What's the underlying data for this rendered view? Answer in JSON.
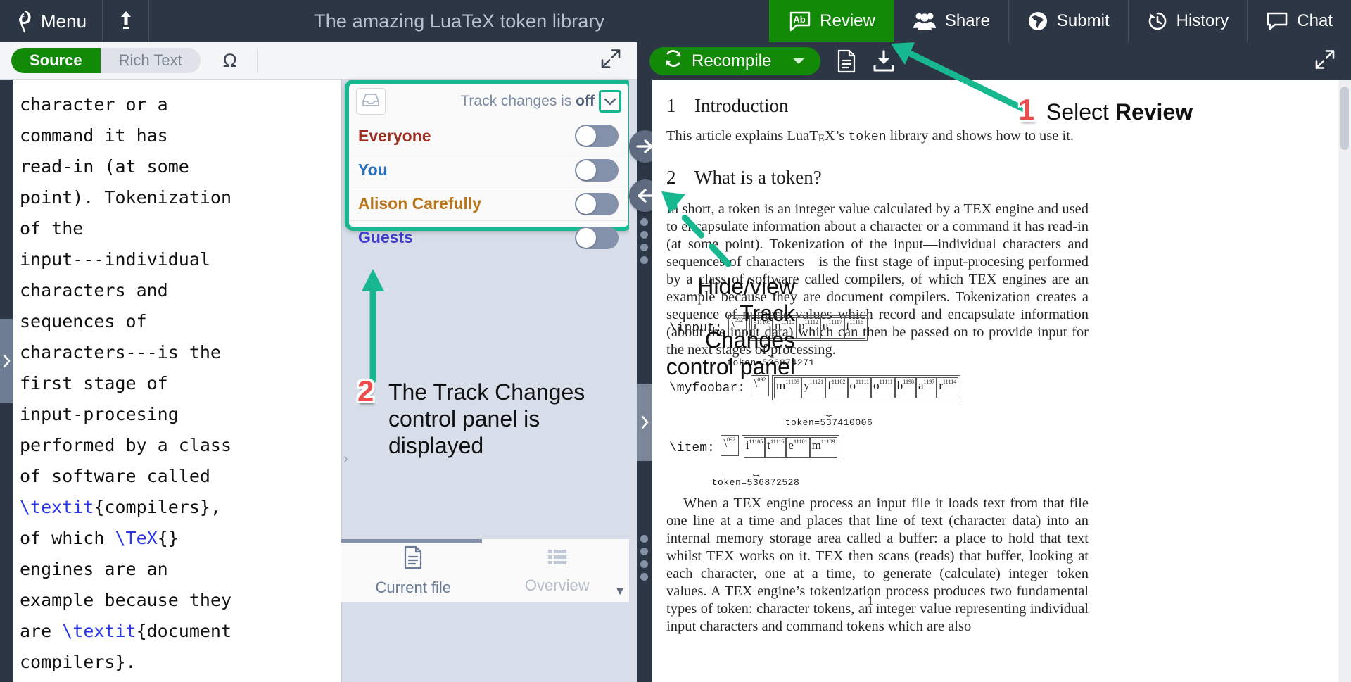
{
  "topnav": {
    "menu_label": "Menu",
    "logo_icon": "overleaf-leaf-logo",
    "upload_icon": "upload-arrow-icon",
    "project_title": "The amazing LuaTeX token library",
    "buttons": [
      {
        "label": "Review",
        "icon": "review-speech-ab-icon",
        "active": true
      },
      {
        "label": "Share",
        "icon": "people-group-icon",
        "active": false
      },
      {
        "label": "Submit",
        "icon": "globe-icon",
        "active": false
      },
      {
        "label": "History",
        "icon": "history-clock-icon",
        "active": false
      },
      {
        "label": "Chat",
        "icon": "chat-bubble-icon",
        "active": false
      }
    ]
  },
  "editor_toolbar": {
    "source_label": "Source",
    "richtext_label": "Rich Text",
    "omega_label": "Ω",
    "expand_icon": "expand-diagonal-icon"
  },
  "pdf_toolbar": {
    "recompile_label": "Recompile",
    "recompile_icon": "refresh-icon",
    "caret_icon": "chevron-down-icon",
    "logs_icon": "file-log-icon",
    "download_icon": "download-icon",
    "expand_icon": "expand-diagonal-icon"
  },
  "editor": {
    "lines": [
      "character or a",
      "command it has",
      "read-in (at some",
      "point). Tokenization",
      "of the",
      "input---individual",
      "characters and",
      "sequences of",
      "characters---is the",
      "first stage of",
      "input-procesing",
      "performed by a class",
      "of software called",
      "\\textit{compilers},",
      "of which \\TeX{}",
      "engines are an",
      "example because they",
      "are \\textit{document",
      "compilers}."
    ]
  },
  "track_changes_panel": {
    "inbox_icon": "inbox-tray-icon",
    "status_prefix": "Track changes is ",
    "status_value": "off",
    "caret_icon": "chevron-down-icon",
    "rows": [
      {
        "name": "Everyone",
        "color": "#9c2c20",
        "enabled": false
      },
      {
        "name": "You",
        "color": "#2a6fbd",
        "enabled": false
      },
      {
        "name": "Alison Carefully",
        "color": "#b9751b",
        "enabled": false
      },
      {
        "name": "Guests",
        "color": "#3c3cc8",
        "enabled": false
      }
    ]
  },
  "review_tabs": {
    "current_file": {
      "label": "Current file",
      "icon": "document-icon",
      "selected": true
    },
    "overview": {
      "label": "Overview",
      "icon": "list-icon",
      "selected": false
    },
    "scroll_down_icon": "caret-down-icon"
  },
  "divider": {
    "arrow_right_icon": "arrow-right-circle-icon",
    "arrow_left_icon": "arrow-left-circle-icon",
    "grip_icon": "grip-dots-icon",
    "handle_icon": "chevron-right-icon"
  },
  "left_rail": {
    "handle_icon": "chevron-right-icon"
  },
  "pdf": {
    "sections": [
      {
        "num": "1",
        "title": "Introduction"
      },
      {
        "num": "2",
        "title": "What is a token?"
      }
    ],
    "intro_paragraph_pre": "This article explains LuaT",
    "intro_paragraph_code": "token",
    "intro_paragraph_post": " library and shows how to use it.",
    "paragraph_2": "In short, a token is an integer value calculated by a TEX engine and used to encapsulate information about a character or a command it has read-in (at some point). Tokenization of the input—individual characters and sequences of characters—is the first stage of input-procesing performed by a class of software called compilers, of which TEX engines are an example because they are document compilers. Tokenization creates a sequence of numeric values which record and encapsulate information (about the input data) which can then be passed on to provide input for the next stages of processing.",
    "paragraph_3": "When a TEX engine process an input file it loads text from that file one line at a time and places that line of text (character data) into an internal memory storage area called a buffer: a place to hold that text whilst TEX works on it. TEX then scans (reads) that buffer, looking at each character, one at a time, to generate (calculate) integer token values. A TEX engine’s tokenization process produces two fundamental types of token: character tokens, an integer value representing individual input characters and command tokens which are also",
    "token_diagrams": [
      {
        "command": "\\input:",
        "escape": {
          "ch": "\\",
          "sup": "0",
          "sub": "92"
        },
        "chars": [
          {
            "ch": "i",
            "sup": "11",
            "sub": "105"
          },
          {
            "ch": "n",
            "sup": "11",
            "sub": "110"
          },
          {
            "ch": "p",
            "sup": "11",
            "sub": "112"
          },
          {
            "ch": "u",
            "sup": "11",
            "sub": "117"
          },
          {
            "ch": "t",
            "sup": "11",
            "sub": "116"
          }
        ],
        "token_label": "token=536874271"
      },
      {
        "command": "\\myfoobar:",
        "escape": {
          "ch": "\\",
          "sup": "0",
          "sub": "92"
        },
        "chars": [
          {
            "ch": "m",
            "sup": "11",
            "sub": "109"
          },
          {
            "ch": "y",
            "sup": "11",
            "sub": "121"
          },
          {
            "ch": "f",
            "sup": "11",
            "sub": "102"
          },
          {
            "ch": "o",
            "sup": "11",
            "sub": "111"
          },
          {
            "ch": "o",
            "sup": "11",
            "sub": "111"
          },
          {
            "ch": "b",
            "sup": "11",
            "sub": "98"
          },
          {
            "ch": "a",
            "sup": "11",
            "sub": "97"
          },
          {
            "ch": "r",
            "sup": "11",
            "sub": "114"
          }
        ],
        "token_label": "token=537410006"
      },
      {
        "command": "\\item:",
        "escape": {
          "ch": "\\",
          "sup": "0",
          "sub": "92"
        },
        "chars": [
          {
            "ch": "i",
            "sup": "11",
            "sub": "105"
          },
          {
            "ch": "t",
            "sup": "11",
            "sub": "116"
          },
          {
            "ch": "e",
            "sup": "11",
            "sub": "101"
          },
          {
            "ch": "m",
            "sup": "11",
            "sub": "109"
          }
        ],
        "token_label": "token=536872528"
      }
    ],
    "page_number": "1"
  },
  "annotations": [
    {
      "badge": "1",
      "text_plain": "Select ",
      "text_bold": "Review"
    },
    {
      "badge": "2",
      "text": "The Track Changes control panel is displayed"
    },
    {
      "badge": "",
      "text": "Hide/view Track Changes control panel"
    }
  ],
  "colors": {
    "nav_bg": "#2c3645",
    "accent_green": "#138a07",
    "annotation_green": "#17b890",
    "badge_red": "#f04b4b",
    "toggle_off": "#8491aa"
  }
}
